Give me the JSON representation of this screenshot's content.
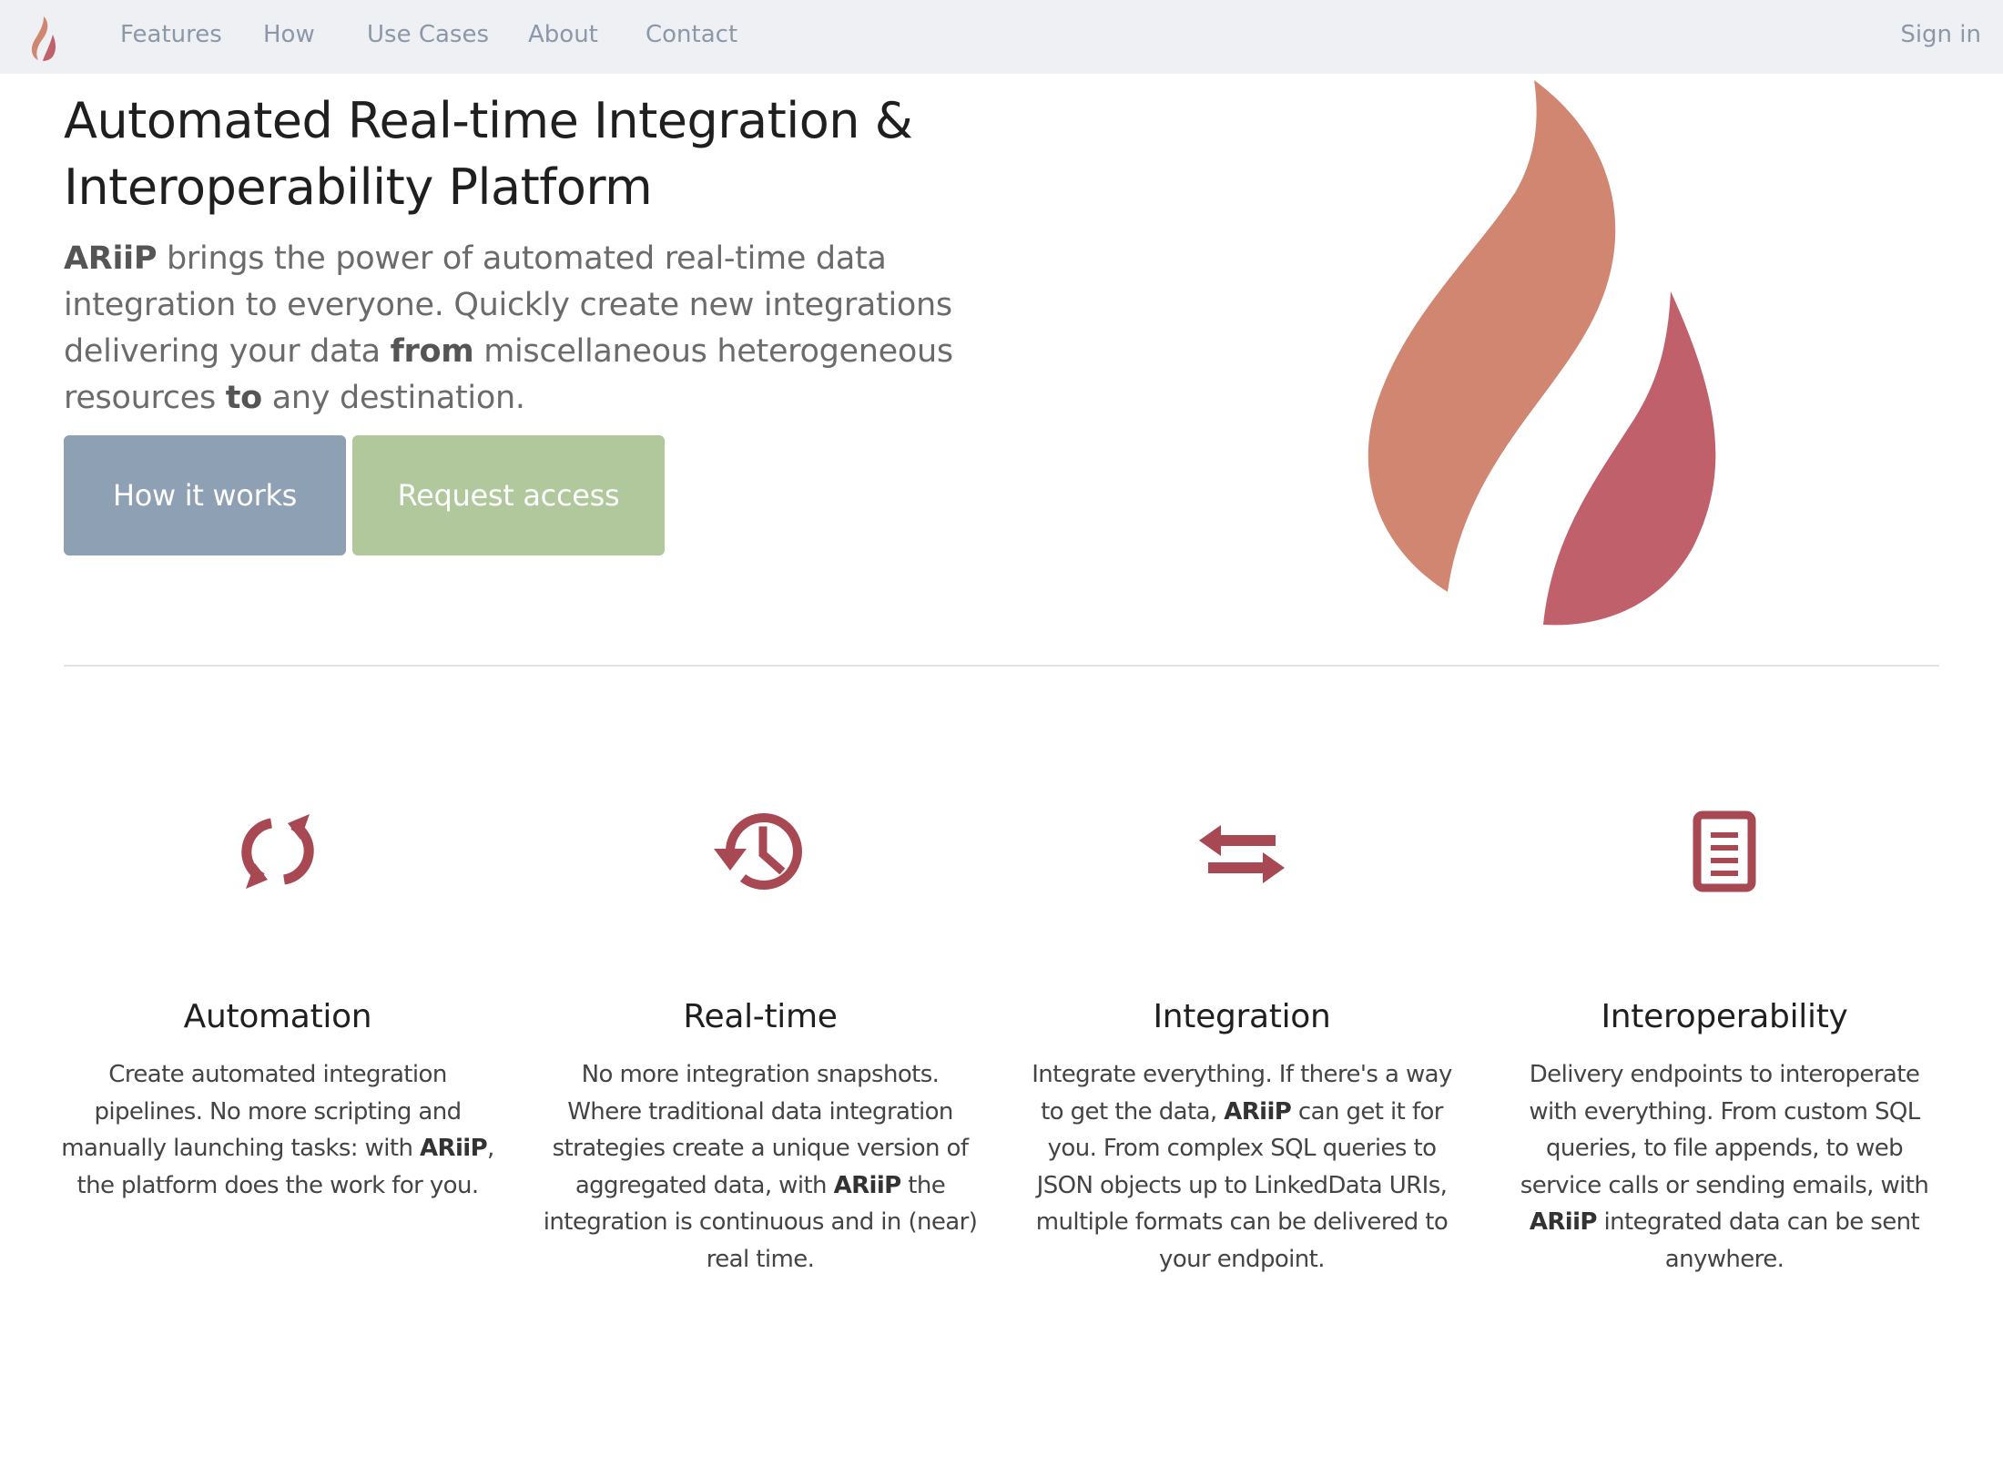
{
  "nav": {
    "logo_icon": "flame-logo-icon",
    "items": [
      {
        "label": "Features"
      },
      {
        "label": "How"
      },
      {
        "label": "Use Cases"
      },
      {
        "label": "About"
      },
      {
        "label": "Contact"
      }
    ],
    "signin_label": "Sign in"
  },
  "hero": {
    "title_line1": "Automated Real-time Integration &",
    "title_line2": "Interoperability Platform",
    "lead": {
      "brand": "ARiiP",
      "part1": " brings the power of automated real-time data integration to everyone. Quickly create new integrations delivering your data ",
      "from": "from",
      "part2": " miscellaneous heterogeneous resources ",
      "to": "to",
      "part3": " any destination."
    },
    "buttons": {
      "how_label": "How it works",
      "request_label": "Request access"
    },
    "logo_icon": "flame-logo-icon"
  },
  "colors": {
    "nav_bg": "#eff0f3",
    "nav_text": "#8a98a9",
    "btn_how": "#8ea0b4",
    "btn_request": "#b0c89c",
    "flame_orange": "#d08670",
    "flame_red": "#c0606b",
    "icon_red": "#a84852"
  },
  "features": [
    {
      "icon": "refresh-icon",
      "title": "Automation",
      "text_a": "Create automated integration pipelines. No more scripting and manually launching tasks: with ",
      "brand": "ARiiP",
      "text_b": ", the platform does the work for you."
    },
    {
      "icon": "history-icon",
      "title": "Real-time",
      "text_a": "No more integration snapshots. Where traditional data integration strategies create a unique version of aggregated data, with ",
      "brand": "ARiiP",
      "text_b": " the integration is continuous and in (near) real time."
    },
    {
      "icon": "exchange-arrows-icon",
      "title": "Integration",
      "text_a": "Integrate everything. If there's a way to get the data, ",
      "brand": "ARiiP",
      "text_b": " can get it for you. From complex SQL queries to JSON objects up to LinkedData URIs, multiple formats can be delivered to your endpoint."
    },
    {
      "icon": "document-icon",
      "title": "Interoperability",
      "text_a": "Delivery endpoints to interoperate with everything. From custom SQL queries, to file appends, to web service calls or sending emails, with ",
      "brand": "ARiiP",
      "text_b": " integrated data can be sent anywhere."
    }
  ]
}
